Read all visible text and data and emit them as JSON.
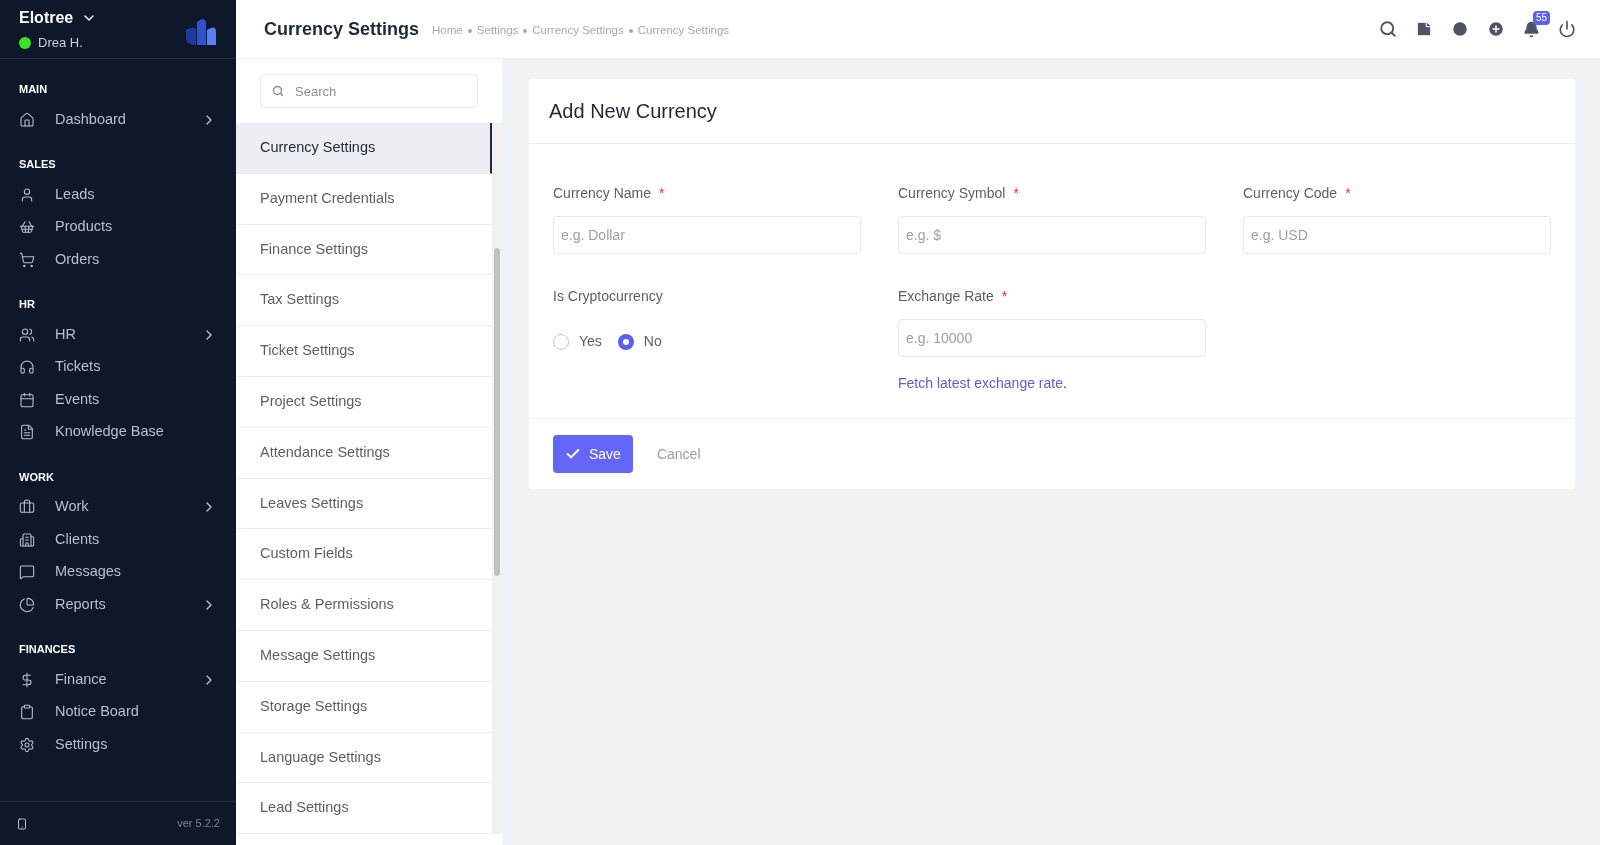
{
  "sidebar": {
    "company": "Elotree",
    "user": {
      "name": "Drea H.",
      "online": true
    },
    "sections": [
      {
        "heading": "MAIN",
        "items": [
          {
            "label": "Dashboard",
            "has_submenu": true
          }
        ]
      },
      {
        "heading": "SALES",
        "items": [
          {
            "label": "Leads",
            "has_submenu": false
          },
          {
            "label": "Products",
            "has_submenu": false
          },
          {
            "label": "Orders",
            "has_submenu": false
          }
        ]
      },
      {
        "heading": "HR",
        "items": [
          {
            "label": "HR",
            "has_submenu": true
          },
          {
            "label": "Tickets",
            "has_submenu": false
          },
          {
            "label": "Events",
            "has_submenu": false
          },
          {
            "label": "Knowledge Base",
            "has_submenu": false
          }
        ]
      },
      {
        "heading": "WORK",
        "items": [
          {
            "label": "Work",
            "has_submenu": true
          },
          {
            "label": "Clients",
            "has_submenu": false
          },
          {
            "label": "Messages",
            "has_submenu": false
          },
          {
            "label": "Reports",
            "has_submenu": true
          }
        ]
      },
      {
        "heading": "FINANCES",
        "items": [
          {
            "label": "Finance",
            "has_submenu": true
          },
          {
            "label": "Notice Board",
            "has_submenu": false
          },
          {
            "label": "Settings",
            "has_submenu": false
          }
        ]
      }
    ],
    "version": "ver 5.2.2"
  },
  "header": {
    "title": "Currency Settings",
    "breadcrumb": [
      "Home",
      "Settings",
      "Currency Settings",
      "Currency Settings"
    ],
    "notification_count": "55"
  },
  "settings_menu": {
    "search": {
      "placeholder": "Search"
    },
    "items": [
      {
        "label": "Currency Settings",
        "selected": true
      },
      {
        "label": "Payment Credentials",
        "selected": false
      },
      {
        "label": "Finance Settings",
        "selected": false
      },
      {
        "label": "Tax Settings",
        "selected": false
      },
      {
        "label": "Ticket Settings",
        "selected": false
      },
      {
        "label": "Project Settings",
        "selected": false
      },
      {
        "label": "Attendance Settings",
        "selected": false
      },
      {
        "label": "Leaves Settings",
        "selected": false
      },
      {
        "label": "Custom Fields",
        "selected": false
      },
      {
        "label": "Roles & Permissions",
        "selected": false
      },
      {
        "label": "Message Settings",
        "selected": false
      },
      {
        "label": "Storage Settings",
        "selected": false
      },
      {
        "label": "Language Settings",
        "selected": false
      },
      {
        "label": "Lead Settings",
        "selected": false
      }
    ]
  },
  "form": {
    "title": "Add New Currency",
    "fields": [
      {
        "label": "Currency Name",
        "required_mark": "*",
        "placeholder": "e.g. Dollar"
      },
      {
        "label": "Currency Symbol",
        "required_mark": "*",
        "placeholder": "e.g. $"
      },
      {
        "label": "Currency Code",
        "required_mark": "*",
        "placeholder": "e.g. USD"
      }
    ],
    "crypto": {
      "label": "Is Cryptocurrency",
      "options": [
        {
          "label": "Yes",
          "selected": false
        },
        {
          "label": "No",
          "selected": true
        }
      ]
    },
    "exchange_rate": {
      "label": "Exchange Rate",
      "required_mark": "*",
      "placeholder": "e.g. 10000",
      "link": "Fetch latest exchange rate",
      "link_suffix": "."
    },
    "buttons": {
      "save": "Save",
      "cancel": "Cancel"
    }
  }
}
